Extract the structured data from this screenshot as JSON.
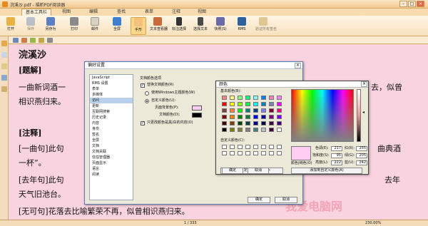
{
  "titlebar": {
    "title": "浣溪沙.pdf - 福昕PDF阅读器",
    "min": "–",
    "max": "□",
    "close": "×"
  },
  "ribbon_tabs": [
    {
      "label": "基本工具栏"
    },
    {
      "label": "视图"
    },
    {
      "label": "编辑"
    },
    {
      "label": "查找"
    },
    {
      "label": "表单"
    },
    {
      "label": "注释"
    },
    {
      "label": "视图"
    }
  ],
  "toolbar": [
    {
      "label": "打开"
    },
    {
      "label": "保存"
    },
    {
      "label": "另存为"
    },
    {
      "label": "打印"
    },
    {
      "label": "邮件"
    },
    {
      "label": "全屏"
    },
    {
      "label": "手形"
    },
    {
      "label": "文本查看器"
    },
    {
      "label": "标注选择"
    },
    {
      "label": "选择文本"
    },
    {
      "label": "快照(S)"
    },
    {
      "label": "RMS"
    },
    {
      "label": "验证所有签名"
    }
  ],
  "document": {
    "lines": [
      "浣溪沙",
      "[题解]",
      "一曲新词酒一",
      "相识燕归来。",
      "[注释]",
      "[一曲句]此句",
      "一杯”。",
      "[去年句]此句",
      "天气旧池台。",
      "[无可句]花落去比喻繁荣不再，似曾相识燕归来。"
    ],
    "right_fragments": [
      "去，似曾",
      "曲典酒",
      "去年"
    ]
  },
  "prefs_dialog": {
    "title": "偏好设置",
    "close": "×",
    "categories": [
      "JavaScript",
      "RMS 设置",
      "表单",
      "多媒体",
      "访问",
      "更新",
      "互联网搜索",
      "历史记录",
      "内容",
      "身份",
      "签名",
      "全屏",
      "文档",
      "文档关联",
      "信任管理器",
      "页面显示",
      "语言",
      "阅读"
    ],
    "selected_index": 4,
    "section_label": "文档颜色选项",
    "opt_replace": "替换文档颜色(R)",
    "opt_windows": "使用Windows主题颜色(W)",
    "opt_custom": "自定义颜色(U):",
    "opt_page_bg": "页面背景色(P):",
    "opt_text": "文档颜色(D):",
    "opt_only_black": "只更改颜色是黑/白的内容(O)",
    "ok": "确定",
    "cancel": "取消"
  },
  "color_dialog": {
    "title": "颜色",
    "close": "×",
    "basic_label": "基本颜色(B):",
    "custom_label": "自定义颜色(C):",
    "define_btn": "规定自定义颜色(D) >>",
    "ok": "确定",
    "cancel": "取消",
    "add_btn": "添加到自定义颜色(A)",
    "color_solid_label": "颜色|纯色(O)",
    "hue_label": "色调(E):",
    "hue": "217",
    "sat_label": "饱和度(S):",
    "sat": "95",
    "lum_label": "亮度(L):",
    "lum": "222",
    "red_label": "红(R):",
    "red": "255",
    "green_label": "绿(G):",
    "green": "205",
    "blue_label": "蓝(U):",
    "blue": "242",
    "preview": "#ffcdf2",
    "basic_colors": [
      "#ff8080",
      "#ffff80",
      "#80ff80",
      "#00ff80",
      "#80ffff",
      "#0080ff",
      "#ff80c0",
      "#ff80ff",
      "#ff0000",
      "#ffff00",
      "#80ff00",
      "#00ff40",
      "#00ffff",
      "#0080c0",
      "#8080c0",
      "#ff00ff",
      "#804040",
      "#ff8040",
      "#00ff00",
      "#008080",
      "#004080",
      "#8080ff",
      "#800040",
      "#ff0080",
      "#800000",
      "#ff8000",
      "#008000",
      "#008040",
      "#0000ff",
      "#0000a0",
      "#800080",
      "#8000ff",
      "#400000",
      "#804000",
      "#004000",
      "#004040",
      "#000080",
      "#000040",
      "#400040",
      "#400080",
      "#000000",
      "#808000",
      "#808040",
      "#808080",
      "#408080",
      "#c0c0c0",
      "#400040",
      "#ffffff"
    ]
  },
  "statusbar": {
    "page": "1 / 333",
    "zoom": "230.00%"
  },
  "watermark": "我爱电脑网"
}
